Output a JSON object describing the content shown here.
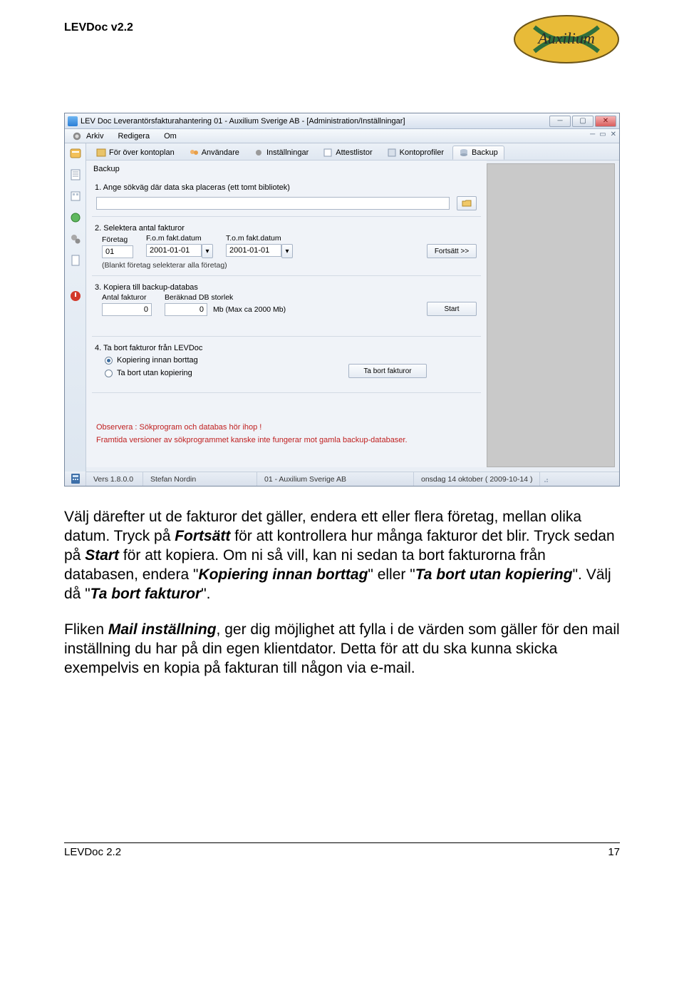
{
  "doc_header": "LEVDoc v2.2",
  "logo_text": "Auxilium",
  "window": {
    "title": "LEV Doc  Leverantörsfakturahantering  01 - Auxilium Sverige AB - [Administration/Inställningar]"
  },
  "menu": {
    "arkiv": "Arkiv",
    "redigera": "Redigera",
    "om": "Om"
  },
  "tabs": {
    "kontoplan": "För över kontoplan",
    "anvandare": "Användare",
    "installningar": "Inställningar",
    "attestlistor": "Attestlistor",
    "kontoprofiler": "Kontoprofiler",
    "backup": "Backup"
  },
  "panel_title": "Backup",
  "sections": {
    "s1": {
      "head": "1. Ange sökväg där data ska placeras (ett tomt bibliotek)",
      "path_value": ""
    },
    "s2": {
      "head": "2. Selektera antal fakturor",
      "lbl_foretag": "Företag",
      "lbl_from": "F.o.m fakt.datum",
      "lbl_tom": "T.o.m fakt.datum",
      "val_foretag": "01",
      "val_from": "2001-01-01",
      "val_tom": "2001-01-01",
      "btn_fortsatt": "Fortsätt >>",
      "hint": "(Blankt företag selekterar alla företag)"
    },
    "s3": {
      "head": "3. Kopiera till backup-databas",
      "lbl_antal": "Antal fakturor",
      "lbl_storlek": "Beräknad DB storlek",
      "val_antal": "0",
      "val_storlek": "0",
      "mb": "Mb    (Max ca 2000 Mb)",
      "btn_start": "Start"
    },
    "s4": {
      "head": "4. Ta bort fakturor från LEVDoc",
      "opt_kopiering": "Kopiering innan borttag",
      "opt_utan": "Ta bort utan kopiering",
      "btn_tabort": "Ta bort fakturor"
    },
    "warn1": "Observera : Sökprogram och databas hör ihop !",
    "warn2": "Framtida versioner av sökprogrammet kanske inte fungerar mot gamla backup-databaser."
  },
  "status": {
    "version": "Vers 1.8.0.0",
    "user": "Stefan Nordin",
    "company": "01 - Auxilium Sverige AB",
    "date": "onsdag 14 oktober ( 2009-10-14 )"
  },
  "body": {
    "p1a": "Välj därefter ut de fakturor det gäller, endera ett eller flera företag, mellan olika datum. Tryck på ",
    "p1b": "Fortsätt",
    "p1c": " för att kontrollera hur många fakturor det blir. Tryck sedan på ",
    "p1d": "Start",
    "p1e": " för att kopiera. Om ni så vill, kan ni sedan ta bort fakturorna från databasen, endera \"",
    "p1f": "Kopiering innan borttag",
    "p1g": "\" eller \"",
    "p1h": "Ta bort utan kopiering",
    "p1i": "\". Välj då \"",
    "p1j": "Ta bort fakturor",
    "p1k": "\".",
    "p2a": "Fliken ",
    "p2b": "Mail inställning",
    "p2c": ", ger dig möjlighet att fylla i de värden som gäller för den mail inställning du har på din egen klientdator. Detta för att du ska kunna skicka exempelvis en kopia på fakturan till någon via e-mail."
  },
  "footer": {
    "left": "LEVDoc 2.2",
    "right": "17"
  }
}
